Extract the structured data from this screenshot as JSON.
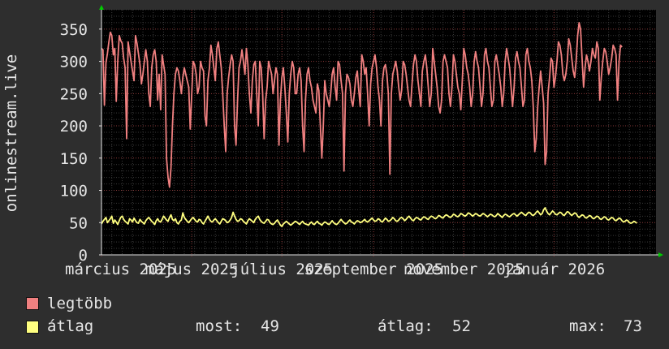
{
  "chart_data": {
    "type": "line",
    "ylabel": "onlinestream.live",
    "ylim": [
      0,
      380
    ],
    "yticks": [
      0,
      50,
      100,
      150,
      200,
      250,
      300,
      350
    ],
    "x_tick_labels": [
      "március 2025",
      "május 2025",
      "július 2025",
      "szeptember 2025",
      "november 2025",
      "január 2026"
    ],
    "x_range_days": [
      0,
      375
    ],
    "x_tick_days": [
      0,
      61,
      122,
      184,
      245,
      306
    ],
    "grid": true,
    "colors": {
      "max": "#f08080",
      "avg": "#ffff80",
      "background": "#000000",
      "grid": "#808080",
      "axis_arrow": "#00cc00"
    },
    "series": [
      {
        "name": "legtöbb",
        "daily_step": 1,
        "values": [
          320,
          318,
          232,
          298,
          312,
          330,
          345,
          340,
          310,
          320,
          238,
          300,
          340,
          332,
          328,
          305,
          290,
          180,
          330,
          315,
          300,
          285,
          270,
          340,
          328,
          312,
          295,
          265,
          280,
          300,
          318,
          300,
          250,
          230,
          290,
          310,
          318,
          300,
          240,
          280,
          225,
          310,
          295,
          280,
          150,
          120,
          105,
          135,
          200,
          250,
          280,
          290,
          285,
          270,
          250,
          275,
          290,
          280,
          270,
          260,
          195,
          248,
          300,
          295,
          280,
          250,
          260,
          300,
          290,
          285,
          215,
          200,
          270,
          290,
          325,
          310,
          290,
          270,
          320,
          330,
          310,
          290,
          250,
          200,
          160,
          250,
          275,
          295,
          310,
          300,
          200,
          170,
          240,
          290,
          300,
          318,
          300,
          280,
          320,
          295,
          250,
          220,
          270,
          295,
          300,
          250,
          200,
          300,
          290,
          250,
          180,
          240,
          260,
          300,
          290,
          280,
          250,
          270,
          290,
          280,
          170,
          240,
          275,
          290,
          260,
          220,
          175,
          250,
          280,
          300,
          290,
          250,
          250,
          280,
          290,
          270,
          200,
          160,
          240,
          280,
          290,
          270,
          260,
          240,
          230,
          220,
          265,
          255,
          200,
          150,
          200,
          270,
          250,
          240,
          230,
          250,
          280,
          290,
          260,
          240,
          300,
          295,
          270,
          250,
          130,
          250,
          280,
          275,
          265,
          240,
          230,
          250,
          275,
          285,
          255,
          230,
          310,
          300,
          280,
          290,
          250,
          200,
          265,
          290,
          300,
          310,
          290,
          260,
          240,
          200,
          270,
          290,
          295,
          280,
          250,
          125,
          250,
          280,
          290,
          300,
          285,
          260,
          240,
          255,
          300,
          295,
          280,
          260,
          240,
          230,
          265,
          295,
          310,
          300,
          270,
          250,
          230,
          285,
          300,
          310,
          290,
          260,
          230,
          250,
          320,
          300,
          280,
          260,
          230,
          220,
          240,
          300,
          310,
          300,
          290,
          250,
          230,
          260,
          310,
          300,
          280,
          260,
          250,
          225,
          270,
          320,
          310,
          290,
          280,
          260,
          230,
          250,
          300,
          315,
          300,
          290,
          260,
          230,
          250,
          310,
          320,
          300,
          290,
          260,
          230,
          240,
          300,
          310,
          295,
          280,
          260,
          230,
          250,
          300,
          320,
          305,
          290,
          260,
          230,
          260,
          305,
          315,
          300,
          290,
          260,
          230,
          240,
          310,
          320,
          300,
          290,
          270,
          230,
          160,
          180,
          230,
          260,
          285,
          260,
          235,
          140,
          160,
          250,
          275,
          305,
          300,
          260,
          275,
          300,
          330,
          325,
          310,
          280,
          270,
          280,
          300,
          335,
          325,
          305,
          285,
          275,
          300,
          340,
          360,
          350,
          305,
          260,
          290,
          310,
          300,
          285,
          300,
          320,
          310,
          305,
          330,
          320,
          240,
          275,
          300,
          320,
          315,
          300,
          280,
          290,
          305,
          325,
          320,
          310,
          240,
          300,
          325,
          322
        ]
      },
      {
        "name": "átlag",
        "daily_step": 1,
        "values": [
          48,
          52,
          55,
          58,
          50,
          53,
          56,
          60,
          49,
          54,
          51,
          47,
          53,
          58,
          60,
          55,
          52,
          50,
          48,
          56,
          54,
          51,
          57,
          53,
          50,
          49,
          55,
          52,
          50,
          48,
          53,
          56,
          58,
          55,
          52,
          50,
          47,
          53,
          56,
          52,
          51,
          55,
          60,
          57,
          54,
          52,
          58,
          62,
          55,
          53,
          56,
          50,
          48,
          52,
          54,
          65,
          58,
          55,
          52,
          50,
          53,
          56,
          58,
          55,
          52,
          51,
          55,
          54,
          50,
          48,
          52,
          56,
          60,
          55,
          52,
          51,
          54,
          56,
          53,
          50,
          48,
          52,
          56,
          55,
          53,
          50,
          51,
          54,
          58,
          66,
          60,
          55,
          52,
          53,
          56,
          55,
          52,
          50,
          48,
          53,
          56,
          54,
          52,
          50,
          55,
          58,
          60,
          55,
          52,
          50,
          49,
          52,
          55,
          54,
          50,
          48,
          47,
          49,
          52,
          54,
          50,
          46,
          44,
          48,
          50,
          52,
          50,
          48,
          46,
          48,
          50,
          52,
          51,
          49,
          47,
          50,
          52,
          49,
          48,
          47,
          46,
          49,
          51,
          48,
          47,
          50,
          52,
          49,
          48,
          46,
          49,
          51,
          50,
          48,
          47,
          50,
          53,
          50,
          48,
          47,
          49,
          52,
          55,
          52,
          50,
          48,
          49,
          52,
          54,
          51,
          50,
          48,
          51,
          53,
          52,
          50,
          51,
          53,
          55,
          52,
          51,
          53,
          55,
          57,
          54,
          52,
          53,
          56,
          55,
          52,
          51,
          54,
          57,
          55,
          52,
          53,
          55,
          58,
          56,
          53,
          52,
          54,
          57,
          58,
          56,
          53,
          55,
          58,
          60,
          57,
          54,
          53,
          56,
          58,
          57,
          55,
          54,
          57,
          59,
          58,
          56,
          55,
          58,
          60,
          59,
          57,
          56,
          58,
          61,
          60,
          58,
          57,
          60,
          62,
          61,
          59,
          58,
          60,
          63,
          62,
          60,
          59,
          61,
          64,
          63,
          61,
          60,
          62,
          65,
          64,
          62,
          60,
          62,
          64,
          63,
          61,
          60,
          62,
          64,
          63,
          61,
          59,
          61,
          63,
          62,
          60,
          59,
          61,
          64,
          62,
          60,
          58,
          61,
          63,
          62,
          60,
          59,
          61,
          63,
          64,
          62,
          60,
          62,
          64,
          66,
          64,
          62,
          61,
          64,
          66,
          65,
          62,
          61,
          63,
          66,
          68,
          65,
          62,
          64,
          70,
          73,
          68,
          64,
          62,
          65,
          68,
          66,
          63,
          62,
          64,
          66,
          65,
          62,
          61,
          64,
          67,
          66,
          63,
          61,
          63,
          65,
          64,
          60,
          58,
          60,
          62,
          61,
          58,
          57,
          59,
          61,
          60,
          57,
          56,
          58,
          60,
          59,
          56,
          55,
          57,
          59,
          58,
          55,
          54,
          56,
          58,
          57,
          54,
          53,
          55,
          57,
          56,
          53,
          51,
          52,
          54,
          53,
          50,
          49,
          50,
          52,
          51,
          49
        ]
      }
    ]
  },
  "legend": [
    {
      "label": "legtöbb",
      "color": "#f08080"
    },
    {
      "label": "átlag",
      "color": "#ffff80"
    }
  ],
  "stats": {
    "now_label": "most:",
    "now_value": "49",
    "avg_label": "átlag:",
    "avg_value": "52",
    "max_label": "max:",
    "max_value": "73"
  }
}
